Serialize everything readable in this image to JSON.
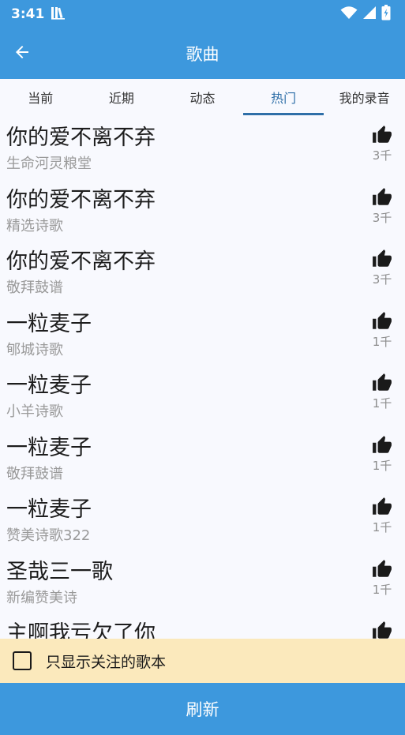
{
  "status_bar": {
    "time": "3:41"
  },
  "app_bar": {
    "title": "歌曲"
  },
  "tabs": [
    {
      "label": "当前",
      "active": false
    },
    {
      "label": "近期",
      "active": false
    },
    {
      "label": "动态",
      "active": false
    },
    {
      "label": "热门",
      "active": true
    },
    {
      "label": "我的录音",
      "active": false
    }
  ],
  "songs": [
    {
      "title": "你的爱不离不弃",
      "book": "生命河灵粮堂",
      "likes": "3千"
    },
    {
      "title": "你的爱不离不弃",
      "book": "精选诗歌",
      "likes": "3千"
    },
    {
      "title": "你的爱不离不弃",
      "book": "敬拜鼓谱",
      "likes": "3千"
    },
    {
      "title": "一粒麦子",
      "book": "郇城诗歌",
      "likes": "1千"
    },
    {
      "title": "一粒麦子",
      "book": "小羊诗歌",
      "likes": "1千"
    },
    {
      "title": "一粒麦子",
      "book": "敬拜鼓谱",
      "likes": "1千"
    },
    {
      "title": "一粒麦子",
      "book": "赞美诗歌322",
      "likes": "1千"
    },
    {
      "title": "圣哉三一歌",
      "book": "新编赞美诗",
      "likes": "1千"
    },
    {
      "title": "主啊我亏欠了你",
      "book": "",
      "likes": ""
    }
  ],
  "filter": {
    "label": "只显示关注的歌本",
    "checked": false
  },
  "refresh_button": {
    "label": "刷新"
  },
  "colors": {
    "primary": "#3d98dd",
    "tab_active": "#2f6fa8",
    "filter_bg": "#fbe9bc",
    "background": "#f8f9fe"
  },
  "icons": {
    "back": "arrow-back-icon",
    "like": "thumb-up-icon",
    "wifi": "wifi-icon",
    "signal": "signal-icon",
    "battery": "battery-charging-icon"
  }
}
